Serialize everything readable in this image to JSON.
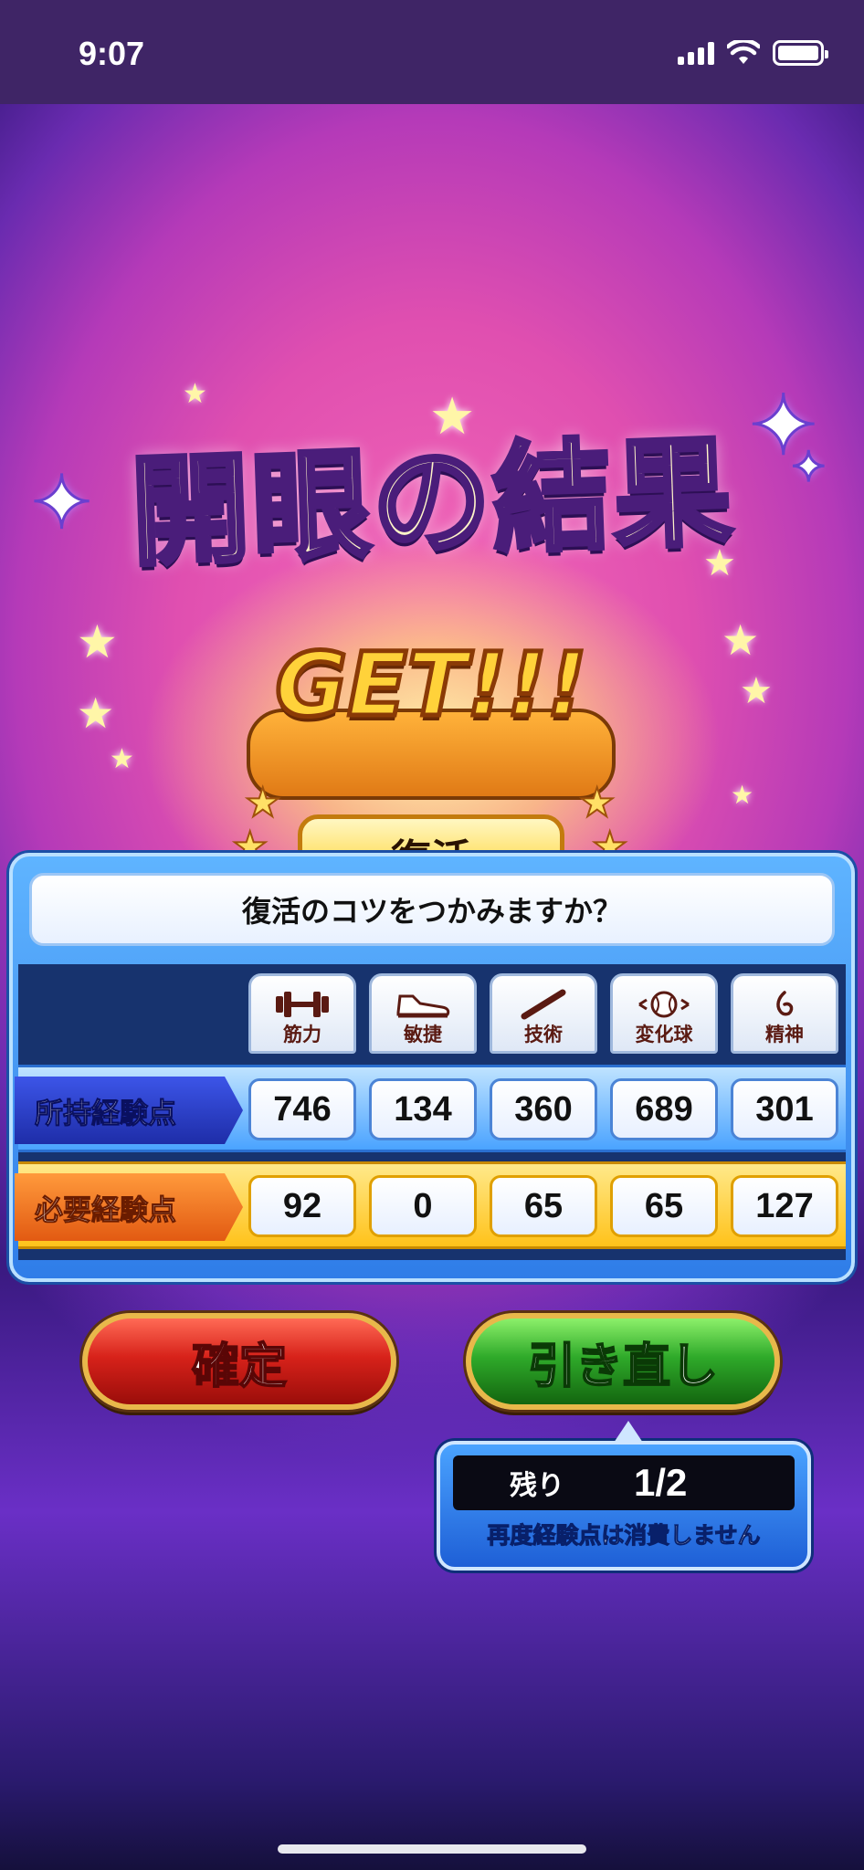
{
  "status_bar": {
    "time": "9:07"
  },
  "title": "開眼の結果",
  "result": {
    "get_label": "GET!!!",
    "skill_name": "復活"
  },
  "dialog": {
    "question": "復活のコツをつかみますか？",
    "categories": [
      {
        "label": "筋力",
        "icon": "dumbbell-icon"
      },
      {
        "label": "敏捷",
        "icon": "shoe-icon"
      },
      {
        "label": "技術",
        "icon": "bat-icon"
      },
      {
        "label": "変化球",
        "icon": "ball-icon"
      },
      {
        "label": "精神",
        "icon": "spirit-icon"
      }
    ],
    "owned_label": "所持経験点",
    "owned_values": [
      "746",
      "134",
      "360",
      "689",
      "301"
    ],
    "required_label": "必要経験点",
    "required_values": [
      "92",
      "0",
      "65",
      "65",
      "127"
    ]
  },
  "buttons": {
    "confirm": "確定",
    "redraw": "引き直し"
  },
  "remaining": {
    "label": "残り",
    "count": "1/2",
    "note": "再度経験点は消費しません"
  },
  "colors": {
    "confirm_button": "#d7221a",
    "redraw_button": "#2faa2a",
    "panel_blue": "#2f7de8",
    "required_row_yellow": "#ffc21a"
  }
}
